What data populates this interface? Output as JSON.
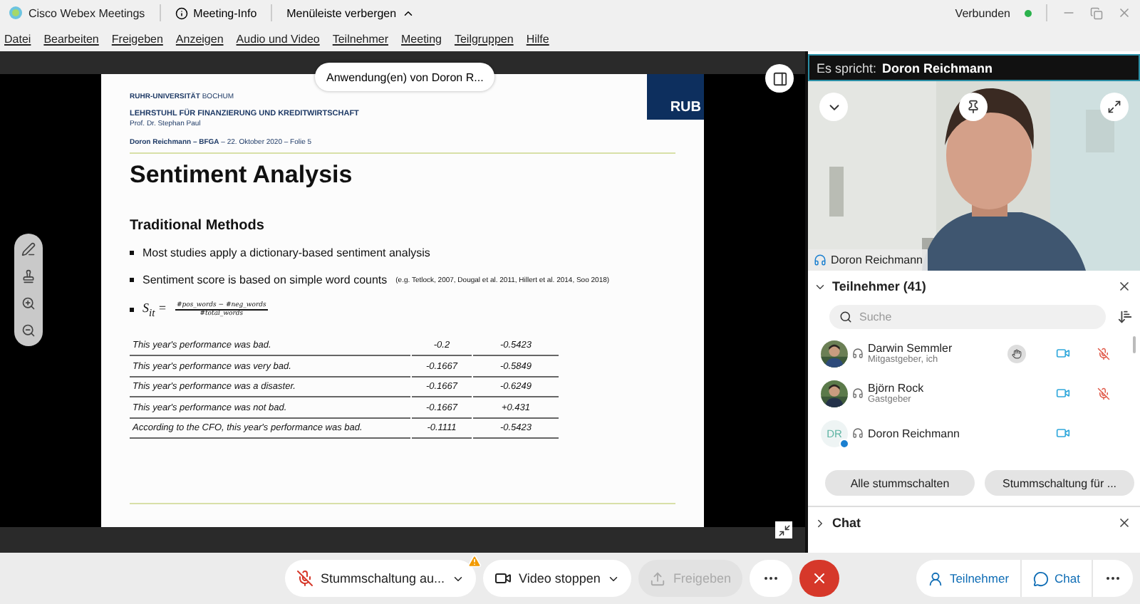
{
  "title_bar": {
    "app_name": "Cisco Webex Meetings",
    "meeting_info": "Meeting-Info",
    "menu_toggle": "Menüleiste verbergen",
    "status": "Verbunden",
    "connected": true
  },
  "menu": [
    "Datei",
    "Bearbeiten",
    "Freigeben",
    "Anzeigen",
    "Audio und Video",
    "Teilnehmer",
    "Meeting",
    "Teilgruppen",
    "Hilfe"
  ],
  "share": {
    "label": "Anwendung(en) von Doron R...",
    "slide": {
      "university": "**RUHR-UNIVERSITÄT** BOCHUM",
      "chair": "LEHRSTUHL FÜR FINANZIERUNG UND KREDITWIRTSCHAFT",
      "professor": "Prof. Dr. Stephan Paul",
      "footer_line": "**Doron Reichmann – BFGA** – 22. Oktober 2020 – Folie 5",
      "logo": "RUB",
      "title": "Sentiment Analysis",
      "subtitle": "Traditional Methods",
      "bullets": [
        {
          "kind": "text",
          "text": "Most studies apply a dictionary-based sentiment analysis"
        },
        {
          "kind": "text",
          "text": "Sentiment score is based on simple word counts",
          "note": "(e.g. Tetlock, 2007, Dougal et al. 2011, Hillert et al. 2014, Soo 2018)"
        },
        {
          "kind": "formula",
          "lhs": "S$_{it}$ =",
          "numerator": "#pos_words − #neg_words",
          "denominator": "#total_words"
        }
      ],
      "table": [
        [
          "This year's performance was bad.",
          "-0.2",
          "-0.5423"
        ],
        [
          "This year's performance was very bad.",
          "-0.1667",
          "-0.5849"
        ],
        [
          "This year's performance was a disaster.",
          "-0.1667",
          "-0.6249"
        ],
        [
          "This year's performance was not bad.",
          "-0.1667",
          "+0.431"
        ],
        [
          "According to the CFO, this year's performance was bad.",
          "-0.1111",
          "-0.5423"
        ]
      ]
    }
  },
  "speaker": {
    "label": "Es spricht:",
    "name": "Doron Reichmann"
  },
  "video": {
    "kind": "picture",
    "name": "Doron Reichmann"
  },
  "participants": {
    "title": "Teilnehmer (41)",
    "expanded": true,
    "search_placeholder": "Suche",
    "items": [
      {
        "name": "Darwin Semmler",
        "role": "Mitgastgeber, ich",
        "hand_raised": true,
        "video": true,
        "muted": true
      },
      {
        "name": "Björn Rock",
        "role": "Gastgeber",
        "hand_raised": false,
        "video": true,
        "muted": true
      },
      {
        "name": "Doron Reichmann",
        "kind": "initials",
        "initials": "DR",
        "hand_raised": false,
        "video": true,
        "muted": false
      }
    ],
    "buttons": [
      "Alle stummschalten",
      "Stummschaltung für ..."
    ]
  },
  "chat": {
    "title": "Chat",
    "expanded": false
  },
  "controls": [
    {
      "kind": "mute",
      "label": "Stummschaltung au...",
      "warning": true,
      "disabled": false
    },
    {
      "kind": "video",
      "label": "Video stoppen",
      "disabled": false
    },
    {
      "kind": "share",
      "label": "Freigeben",
      "disabled": true
    },
    {
      "kind": "more"
    },
    {
      "kind": "end"
    }
  ],
  "panel_buttons": [
    {
      "kind": "participants",
      "label": "Teilnehmer"
    },
    {
      "kind": "chat",
      "label": "Chat"
    },
    {
      "kind": "more"
    }
  ]
}
